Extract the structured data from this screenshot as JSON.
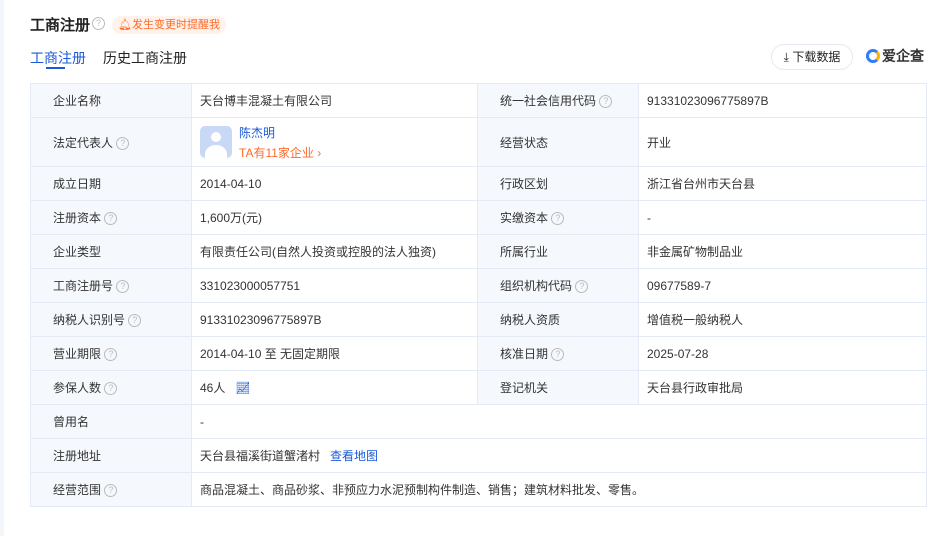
{
  "header": {
    "title": "工商注册",
    "remind": "发生变更时提醒我",
    "download": "下载数据",
    "logo": "爱企查"
  },
  "tabs": [
    {
      "label": "工商注册"
    },
    {
      "label": "历史工商注册"
    }
  ],
  "rows": [
    {
      "l1": "企业名称",
      "v1": "天台博丰混凝土有限公司",
      "l2": "统一社会信用代码",
      "v2": "91331023096775897B"
    },
    {
      "l1": "法定代表人",
      "person": "陈杰明",
      "person_link": "TA有11家企业 ›",
      "l2": "经营状态",
      "v2": "开业"
    },
    {
      "l1": "成立日期",
      "v1": "2014-04-10",
      "l2": "行政区划",
      "v2": "浙江省台州市天台县"
    },
    {
      "l1": "注册资本",
      "v1": "1,600万(元)",
      "l2": "实缴资本",
      "v2": "-"
    },
    {
      "l1": "企业类型",
      "v1": "有限责任公司(自然人投资或控股的法人独资)",
      "l2": "所属行业",
      "v2": "非金属矿物制品业"
    },
    {
      "l1": "工商注册号",
      "v1": "331023000057751",
      "l2": "组织机构代码",
      "v2": "09677589-7"
    },
    {
      "l1": "纳税人识别号",
      "v1": "91331023096775897B",
      "l2": "纳税人资质",
      "v2": "增值税一般纳税人"
    },
    {
      "l1": "营业期限",
      "v1": "2014-04-10 至 无固定期限",
      "l2": "核准日期",
      "v2": "2025-07-28"
    },
    {
      "l1": "参保人数",
      "v1": "46人",
      "l2": "登记机关",
      "v2": "天台县行政审批局"
    },
    {
      "l1": "曾用名",
      "v1": "-"
    },
    {
      "l1": "注册地址",
      "v1": "天台县福溪街道蟹渚村",
      "map": "查看地图"
    },
    {
      "l1": "经营范围",
      "v1": "商品混凝土、商品砂浆、非预应力水泥预制构件制造、销售；建筑材料批发、零售。"
    }
  ]
}
